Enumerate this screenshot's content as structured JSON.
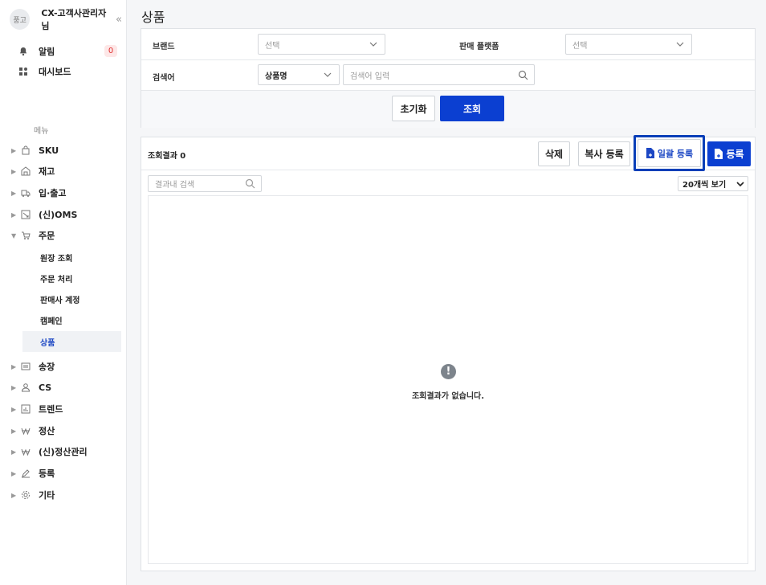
{
  "sidebar": {
    "avatar_text": "풍고",
    "user_name": "CX-고객사관리자님",
    "collapse_glyph": "«",
    "top_items": [
      {
        "label": "알림",
        "badge": "0"
      },
      {
        "label": "대시보드"
      }
    ],
    "menu_caption": "메뉴",
    "nav": [
      {
        "label": "SKU"
      },
      {
        "label": "재고"
      },
      {
        "label": "입·출고"
      },
      {
        "label": "(신)OMS"
      },
      {
        "label": "주문"
      }
    ],
    "order_sub": [
      "원장 조회",
      "주문 처리",
      "판매사 계정",
      "캠페인",
      "상품"
    ],
    "nav_bottom": [
      {
        "label": "송장"
      },
      {
        "label": "CS"
      },
      {
        "label": "트렌드"
      },
      {
        "label": "정산"
      },
      {
        "label": "(신)정산관리"
      },
      {
        "label": "등록"
      },
      {
        "label": "기타"
      }
    ]
  },
  "page": {
    "title": "상품"
  },
  "filters": {
    "brand_label": "브랜드",
    "brand_placeholder": "선택",
    "platform_label": "판매 플랫폼",
    "platform_placeholder": "선택",
    "keyword_label": "검색어",
    "keyword_type": "상품명",
    "keyword_placeholder": "검색어 입력",
    "reset_label": "초기화",
    "search_label": "조회"
  },
  "results": {
    "count_label": "조회결과 0",
    "delete_label": "삭제",
    "copy_register_label": "복사 등록",
    "bulk_register_label": "일괄 등록",
    "register_label": "등록",
    "in_result_placeholder": "결과내 검색",
    "page_size": "20개씩 보기",
    "empty_icon": "!",
    "empty_message": "조회결과가 없습니다."
  },
  "colors": {
    "primary": "#0b3fd1",
    "active_text": "#1c47c4",
    "badge_bg": "#fde7e7",
    "badge_text": "#e03131"
  }
}
